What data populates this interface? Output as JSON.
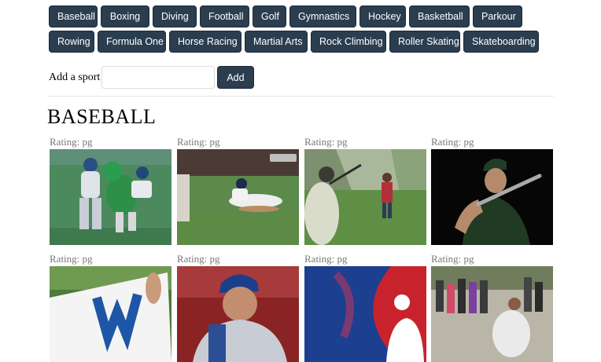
{
  "sport_buttons": {
    "row1": [
      "Baseball",
      "Boxing",
      "Diving",
      "Football",
      "Golf",
      "Gymnastics",
      "Hockey",
      "Basketball",
      "Parkour"
    ],
    "row2": [
      "Rowing",
      "Formula One",
      "Horse Racing",
      "Martial Arts",
      "Rock Climbing",
      "Roller Skating",
      "Skateboarding"
    ]
  },
  "add_form": {
    "label": "Add a sport",
    "input_value": "",
    "button": "Add"
  },
  "section": {
    "title": "BASEBALL"
  },
  "gifs": [
    {
      "rating": "Rating: pg",
      "scene": "field-collision"
    },
    {
      "rating": "Rating: pg",
      "scene": "slide-into-base"
    },
    {
      "rating": "Rating: pg",
      "scene": "backyard-batter"
    },
    {
      "rating": "Rating: pg",
      "scene": "batter-dark-background"
    },
    {
      "rating": "Rating: pg",
      "scene": "fan-with-w-flag"
    },
    {
      "rating": "Rating: pg",
      "scene": "pitcher-closeup"
    },
    {
      "rating": "Rating: pg",
      "scene": "mlb-logo"
    },
    {
      "rating": "Rating: pg",
      "scene": "crowd-celebration"
    }
  ],
  "colors": {
    "button_bg": "#2b3e50",
    "button_text": "#ffffff",
    "rating_text": "#777777"
  }
}
